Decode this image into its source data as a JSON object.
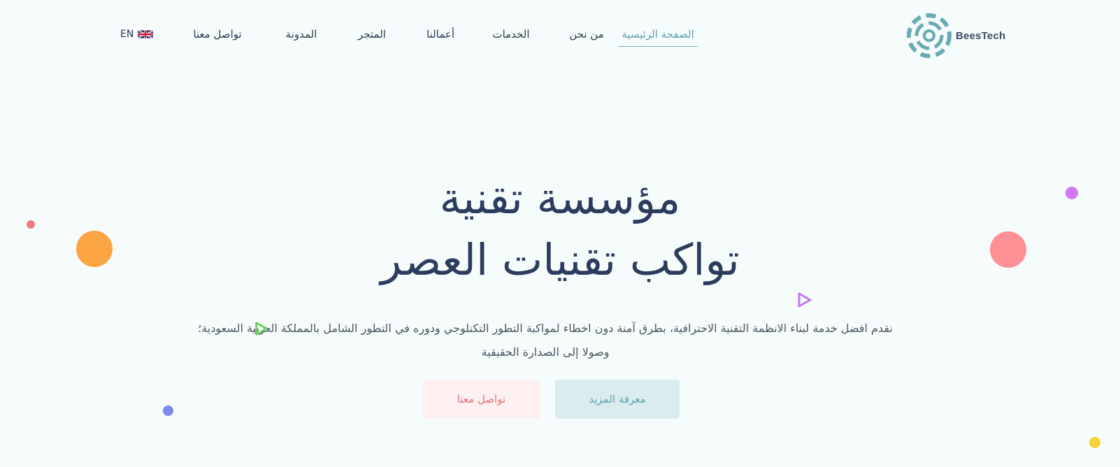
{
  "brand": {
    "name": "BeesTech",
    "logo_color": "#6aaab2"
  },
  "nav": {
    "items": [
      {
        "label": "الصفحة الرئيسية",
        "active": true
      },
      {
        "label": "من نحن"
      },
      {
        "label": "الخدمات"
      },
      {
        "label": "أعمالنا"
      },
      {
        "label": "المتجر"
      },
      {
        "label": "المدونة"
      },
      {
        "label": "تواصل معنا"
      }
    ],
    "language_label": "EN",
    "language_flag_icon": "uk-flag-icon"
  },
  "hero": {
    "title_line1": "مؤسسة تقنية",
    "title_line2": "تواكب تقنيات العصر",
    "description_line1": "نقدم افضل خدمة لبناء الانظمة التقنية الاحترافية، بطرق آمنة دون اخطاء لمواكبة التطور التكنلوجي ودوره في التطور الشامل بالمملكة العربية السعودية؛",
    "description_line2": "وصولا إلى الصدارة الحقيقية"
  },
  "buttons": {
    "learn_more": "معرفة المزيد",
    "contact": "تواصل معنا"
  },
  "colors": {
    "accent": "#6aaab2",
    "title": "#2b3c5e",
    "background": "#f6fcfc",
    "btn_more_bg": "#dbecef",
    "btn_contact_bg": "#fdf0f0",
    "btn_contact_text": "#e07575"
  }
}
